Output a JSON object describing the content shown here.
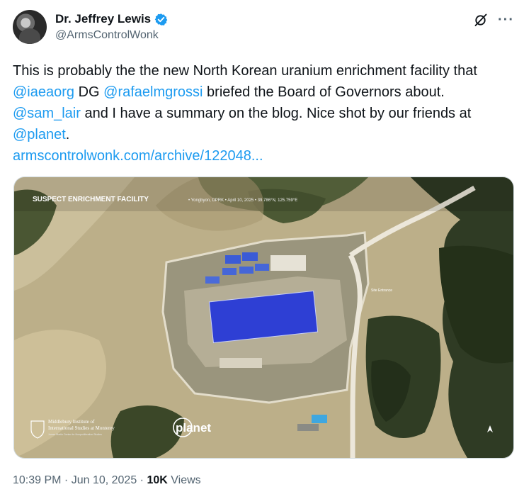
{
  "author": {
    "name": "Dr. Jeffrey Lewis",
    "handle": "@ArmsControlWonk",
    "verified_color": "#1d9bf0"
  },
  "tweet": {
    "text_1": "This is probably the the new North Korean uranium enrichment facility that ",
    "mention_1": "@iaeaorg",
    "text_2": " DG ",
    "mention_2": "@rafaelmgrossi",
    "text_3": " briefed the Board of Governors about. ",
    "mention_3": "@sam_lair",
    "text_4": " and I have a summary on the blog.  Nice shot by our friends at ",
    "mention_4": "@planet",
    "text_5": ".",
    "link": "armscontrolwonk.com/archive/122048..."
  },
  "image": {
    "caption_title": "SUSPECT ENRICHMENT FACILITY",
    "caption_details": "• Yongbyon, DPRK • April 10, 2025 • 39.786°N, 125.759°E",
    "road_label": "Site Entrance",
    "institute_line_1": "Middlebury Institute of",
    "institute_line_2": "International Studies at Monterey",
    "institute_line_3": "James Martin Center for Nonproliferation Studies",
    "planet_logo": "planet"
  },
  "meta": {
    "time": "10:39 PM",
    "sep_1": " · ",
    "date": "Jun 10, 2025",
    "sep_2": " · ",
    "views_count": "10K",
    "views_label": " Views"
  },
  "icons": {
    "grok": "grok-icon",
    "more": "more-icon",
    "verified": "verified-badge-icon"
  },
  "colors": {
    "link": "#1d9bf0",
    "secondary_text": "#536471",
    "roof_blue": "#2e3fd4"
  }
}
